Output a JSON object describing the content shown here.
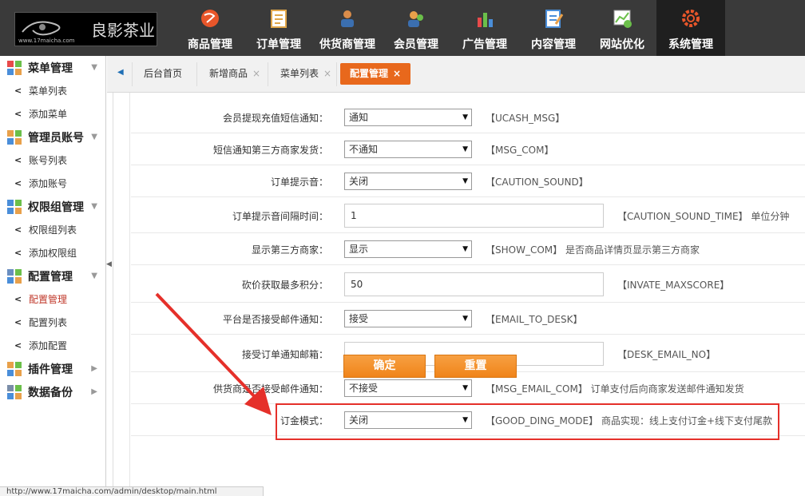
{
  "logo": {
    "brand": "良影茶业",
    "url": "www.17maicha.com"
  },
  "nav": [
    {
      "label": "商品管理",
      "icon": "globe-icon",
      "color": "#e8562a"
    },
    {
      "label": "订单管理",
      "icon": "order-list-icon",
      "color": "#e0a64a"
    },
    {
      "label": "供货商管理",
      "icon": "supplier-icon",
      "color": "#d98c4a"
    },
    {
      "label": "会员管理",
      "icon": "members-icon",
      "color": "#6bbf4a"
    },
    {
      "label": "广告管理",
      "icon": "ad-chart-icon",
      "color": "#e84a4a"
    },
    {
      "label": "内容管理",
      "icon": "content-edit-icon",
      "color": "#4a8ed9"
    },
    {
      "label": "网站优化",
      "icon": "seo-chart-icon",
      "color": "#6bbf4a"
    },
    {
      "label": "系统管理",
      "icon": "gear-icon",
      "color": "#e8562a",
      "active": true
    }
  ],
  "sidebar": {
    "groups": [
      {
        "title": "菜单管理",
        "items": [
          "菜单列表",
          "添加菜单"
        ]
      },
      {
        "title": "管理员账号",
        "items": [
          "账号列表",
          "添加账号"
        ]
      },
      {
        "title": "权限组管理",
        "items": [
          "权限组列表",
          "添加权限组"
        ]
      },
      {
        "title": "配置管理",
        "items": [
          "配置管理",
          "配置列表",
          "添加配置"
        ],
        "active_item": "配置管理"
      },
      {
        "title": "插件管理",
        "items": []
      },
      {
        "title": "数据备份",
        "items": []
      }
    ]
  },
  "tabs": [
    {
      "label": "后台首页",
      "closable": false
    },
    {
      "label": "新增商品",
      "closable": true
    },
    {
      "label": "菜单列表",
      "closable": true
    },
    {
      "label": "配置管理",
      "closable": true,
      "active": true
    }
  ],
  "form": {
    "rows": [
      {
        "label": "会员提现充值短信通知：",
        "type": "select",
        "value": "通知",
        "code": "【UCASH_MSG】",
        "note": ""
      },
      {
        "label": "短信通知第三方商家发货：",
        "type": "select",
        "value": "不通知",
        "code": "【MSG_COM】",
        "note": ""
      },
      {
        "label": "订单提示音：",
        "type": "select",
        "value": "关闭",
        "code": "【CAUTION_SOUND】",
        "note": ""
      },
      {
        "label": "订单提示音间隔时间：",
        "type": "input",
        "value": "1",
        "code": "【CAUTION_SOUND_TIME】",
        "note": "单位分钟"
      },
      {
        "label": "显示第三方商家：",
        "type": "select",
        "value": "显示",
        "code": "【SHOW_COM】",
        "note": "是否商品详情页显示第三方商家"
      },
      {
        "label": "砍价获取最多积分：",
        "type": "input",
        "value": "50",
        "code": "【INVATE_MAXSCORE】",
        "note": ""
      },
      {
        "label": "平台是否接受邮件通知：",
        "type": "select",
        "value": "接受",
        "code": "【EMAIL_TO_DESK】",
        "note": ""
      },
      {
        "label": "接受订单通知邮箱：",
        "type": "input",
        "value": "",
        "code": "【DESK_EMAIL_NO】",
        "note": ""
      },
      {
        "label": "供货商是否接受邮件通知：",
        "type": "select",
        "value": "不接受",
        "code": "【MSG_EMAIL_COM】",
        "note": "订单支付后向商家发送邮件通知发货"
      },
      {
        "label": "订金模式：",
        "type": "select",
        "value": "关闭",
        "code": "【GOOD_DING_MODE】",
        "note": "商品实现：线上支付订金+线下支付尾款"
      }
    ],
    "confirm_label": "确定",
    "reset_label": "重置"
  },
  "status_url": "http://www.17maicha.com/admin/desktop/main.html",
  "colors": {
    "accent": "#e8681c",
    "highlight": "#e5302a",
    "topbar": "#3a3a3a"
  }
}
